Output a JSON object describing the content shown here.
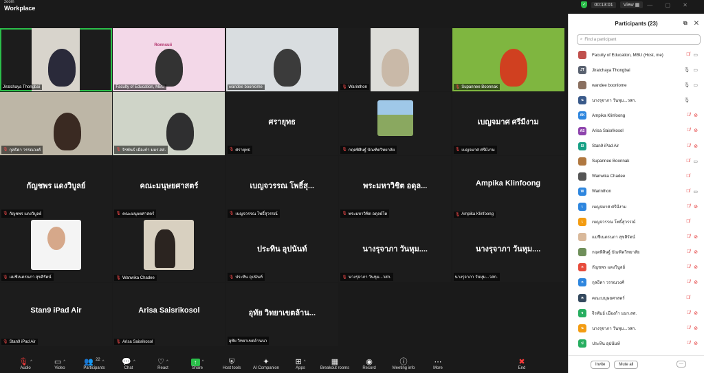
{
  "app": {
    "brand_small": "zoom",
    "brand_big": "Workplace"
  },
  "topbar": {
    "timer": "00:13:01",
    "view_label": "View"
  },
  "grid": {
    "tiles": [
      {
        "name": "Jiratchaya Thongbai",
        "big": "",
        "muted": false
      },
      {
        "name": "Faculty of Education, MBU",
        "big": "",
        "muted": false,
        "slide_title": "Ronnsuii"
      },
      {
        "name": "wandee boonlome",
        "big": "",
        "muted": false
      },
      {
        "name": "Warinthon",
        "big": "",
        "muted": true
      },
      {
        "name": "Supannee Boonnak",
        "big": "",
        "muted": true
      },
      {
        "name": "กุลธิดา วรรณวงศ์",
        "big": "",
        "muted": true
      },
      {
        "name": "จิรพันธ์ เมืองก้า มมร.สส.",
        "big": "",
        "muted": true
      },
      {
        "name": "ศรายุทธ",
        "big": "ศรายุทธ",
        "muted": true
      },
      {
        "name": "กฤตพิสิษฐ์ บัณฑิตวิทยาลัย",
        "big": "",
        "muted": true
      },
      {
        "name": "เบญจมาศ ศรีมีงาม",
        "big": "เบญจมาศ ศรีมีงาม",
        "muted": true
      },
      {
        "name": "กัญชพร แดงวิบูลย์",
        "big": "กัญชพร แดงวิบูลย์",
        "muted": true
      },
      {
        "name": "คณะมนุษยศาสตร์",
        "big": "คณะมนุษยศาสตร์",
        "muted": true
      },
      {
        "name": "เบญจวรรณ โพธิ์สุวรรณ์",
        "big": "เบญจวรรณ โพธิ์สุ...",
        "muted": true
      },
      {
        "name": "พระมหาวิชิต อดุลย์โต",
        "big": "พระมหาวิชิต อดุล...",
        "muted": true
      },
      {
        "name": "Ampika Klinfoong",
        "big": "Ampika Klinfoong",
        "muted": true
      },
      {
        "name": "แม่ชีเนตรนภา สุขสิรัตน์",
        "big": "",
        "muted": true
      },
      {
        "name": "Wanwika Chadee",
        "big": "",
        "muted": true
      },
      {
        "name": "ประทิน อุปนันท์",
        "big": "ประทิน อุปนันท์",
        "muted": true
      },
      {
        "name": "นางรุจาภา วันหุม...วสก.",
        "big": "นางรุจาภา วันหุม....",
        "muted": true
      },
      {
        "name": "นางรุจาภา วันหุม...วสก.",
        "big": "นางรุจาภา วันหุม....",
        "muted": false
      },
      {
        "name": "Stan9 iPad Air",
        "big": "Stan9 iPad Air",
        "muted": true
      },
      {
        "name": "Arisa Saisrikosol",
        "big": "Arisa Saisrikosol",
        "muted": true
      },
      {
        "name": "อุทัย วิทยาเขตล้านนา",
        "big": "อุทัย วิทยาเขตล้าน...",
        "muted": false
      }
    ]
  },
  "toolbar": [
    {
      "label": "Audio",
      "icon": "mic-off-icon",
      "glyph": "🎙",
      "caret": true
    },
    {
      "label": "Video",
      "icon": "camera-icon",
      "glyph": "▭",
      "caret": true
    },
    {
      "label": "Participants",
      "icon": "people-icon",
      "glyph": "👥",
      "count": "22",
      "caret": true
    },
    {
      "label": "Chat",
      "icon": "chat-icon",
      "glyph": "💬",
      "caret": true
    },
    {
      "label": "React",
      "icon": "heart-icon",
      "glyph": "♡",
      "caret": true
    },
    {
      "label": "Share",
      "icon": "share-icon",
      "glyph": "↑",
      "caret": true
    },
    {
      "label": "Host tools",
      "icon": "shield-icon",
      "glyph": "⛨",
      "caret": false
    },
    {
      "label": "AI Companion",
      "icon": "sparkle-icon",
      "glyph": "✦",
      "caret": false
    },
    {
      "label": "Apps",
      "icon": "apps-icon",
      "glyph": "⊞",
      "caret": true
    },
    {
      "label": "Breakout rooms",
      "icon": "grid-icon",
      "glyph": "▦",
      "caret": false
    },
    {
      "label": "Record",
      "icon": "record-icon",
      "glyph": "◉",
      "caret": false
    },
    {
      "label": "Meeting info",
      "icon": "info-icon",
      "glyph": "ⓘ",
      "caret": false
    },
    {
      "label": "More",
      "icon": "more-icon",
      "glyph": "⋯",
      "caret": false
    },
    {
      "label": "End",
      "icon": "end-icon",
      "glyph": "✖",
      "caret": false
    }
  ],
  "panel": {
    "title": "Participants (23)",
    "search_placeholder": "Find a participant",
    "invite_label": "Invite",
    "mute_all_label": "Mute all",
    "more_label": "···",
    "participants": [
      {
        "name": "Faculty of Education, MBU (Host, me)",
        "initials": "",
        "color": "#c0504d",
        "mic": "off",
        "video": "on"
      },
      {
        "name": "Jiratchaya Thongbai",
        "initials": "JT",
        "color": "#5a6270",
        "mic": "on",
        "video": "on"
      },
      {
        "name": "wandee boonlome",
        "initials": "",
        "color": "#8a7060",
        "mic": "on",
        "video": "on"
      },
      {
        "name": "นางรุจาภา วันหุม...วสก.",
        "initials": "น",
        "color": "#3a5a8a",
        "mic": "on",
        "video": "none"
      },
      {
        "name": "Ampika Klinfoong",
        "initials": "AK",
        "color": "#2e86de",
        "mic": "off",
        "video": "off"
      },
      {
        "name": "Arisa Saisrikosol",
        "initials": "AS",
        "color": "#8e44ad",
        "mic": "off",
        "video": "off"
      },
      {
        "name": "Stan9 iPad Air",
        "initials": "SI",
        "color": "#16a085",
        "mic": "off",
        "video": "off"
      },
      {
        "name": "Supannee Boonnak",
        "initials": "",
        "color": "#b07840",
        "mic": "off",
        "video": "on"
      },
      {
        "name": "Wanwika Chadee",
        "initials": "",
        "color": "#555555",
        "mic": "off",
        "video": "none"
      },
      {
        "name": "Warinthon",
        "initials": "W",
        "color": "#2e86de",
        "mic": "off",
        "video": "on"
      },
      {
        "name": "เบญจมาศ ศรีมีงาม",
        "initials": "เ",
        "color": "#2e86de",
        "mic": "off",
        "video": "off"
      },
      {
        "name": "เบญจวรรณ โพธิ์สุวรรณ์",
        "initials": "เ",
        "color": "#f39c12",
        "mic": "off",
        "video": "none"
      },
      {
        "name": "แม่ชีเนตรนภา สุขสิรัตน์",
        "initials": "",
        "color": "#d9b99b",
        "mic": "off",
        "video": "off"
      },
      {
        "name": "กฤตพิสิษฐ์ บัณฑิตวิทยาลัย",
        "initials": "",
        "color": "#6f8f5a",
        "mic": "off",
        "video": "off"
      },
      {
        "name": "กัญชพร แดงวิบูลย์",
        "initials": "ก",
        "color": "#e74c3c",
        "mic": "off",
        "video": "off"
      },
      {
        "name": "กุลธิดา วรรณวงศ์",
        "initials": "ก",
        "color": "#2e86de",
        "mic": "off",
        "video": "off"
      },
      {
        "name": "คณะมนุษยศาสตร์",
        "initials": "ค",
        "color": "#34495e",
        "mic": "off",
        "video": "none"
      },
      {
        "name": "จิรพันธ์ เมืองก้า มมร.สส.",
        "initials": "จ",
        "color": "#27ae60",
        "mic": "off",
        "video": "off"
      },
      {
        "name": "นางรุจาภา วันหุม...วสก.",
        "initials": "น",
        "color": "#f39c12",
        "mic": "off",
        "video": "off"
      },
      {
        "name": "ประทิน อุปนันท์",
        "initials": "ป",
        "color": "#27ae60",
        "mic": "off",
        "video": "off"
      }
    ]
  }
}
